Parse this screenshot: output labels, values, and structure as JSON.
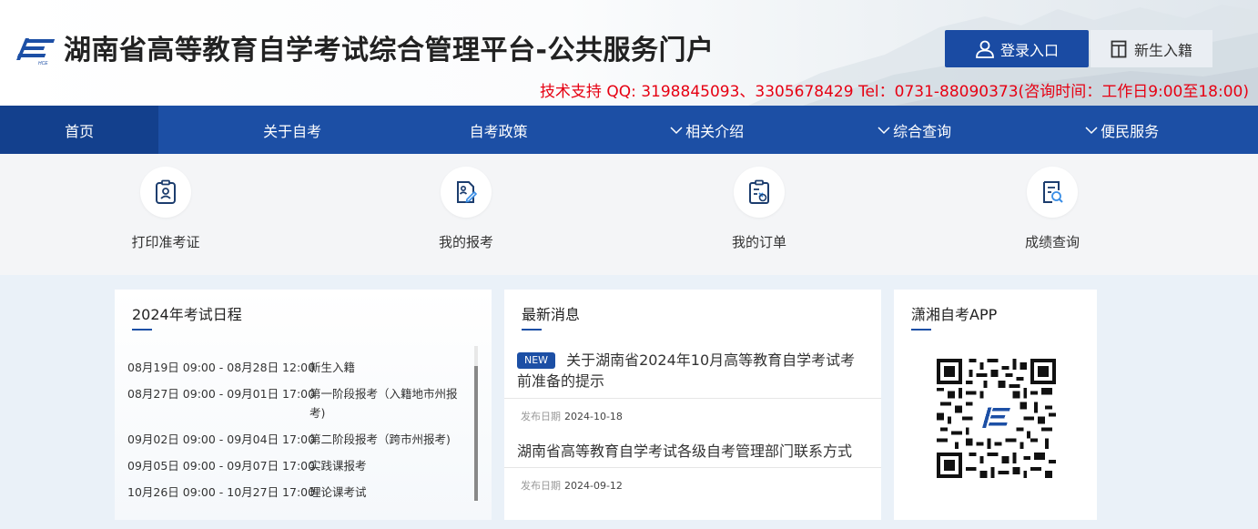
{
  "header": {
    "site_title": "湖南省高等教育自学考试综合管理平台-公共服务门户",
    "login_label": "登录入口",
    "enroll_label": "新生入籍",
    "support_text": "技术支持 QQ: 3198845093、3305678429 Tel：0731-88090373(咨询时间：工作日9:00至18:00)"
  },
  "nav": {
    "items": [
      {
        "label": "首页"
      },
      {
        "label": "关于自考"
      },
      {
        "label": "自考政策"
      },
      {
        "label": "相关介绍"
      },
      {
        "label": "综合查询"
      },
      {
        "label": "便民服务"
      }
    ]
  },
  "shortcuts": [
    {
      "label": "打印准考证",
      "icon": "admission-ticket-icon"
    },
    {
      "label": "我的报考",
      "icon": "registration-file-icon"
    },
    {
      "label": "我的订单",
      "icon": "order-clipboard-icon"
    },
    {
      "label": "成绩查询",
      "icon": "score-search-icon"
    }
  ],
  "schedule": {
    "title": "2024年考试日程",
    "items": [
      {
        "time": "08月19日 09:00 - 08月28日 12:00",
        "text": "新生入籍"
      },
      {
        "time": "08月27日 09:00 - 09月01日 17:00",
        "text": "第一阶段报考（入籍地市州报考)"
      },
      {
        "time": "09月02日 09:00 - 09月04日 17:00",
        "text": "第二阶段报考（跨市州报考)"
      },
      {
        "time": "09月05日 09:00 - 09月07日 17:00",
        "text": "实践课报考"
      },
      {
        "time": "10月26日 09:00 - 10月27日 17:00",
        "text": "理论课考试"
      }
    ]
  },
  "news": {
    "title": "最新消息",
    "badge": "NEW",
    "date_label": "发布日期",
    "items": [
      {
        "title": "关于湖南省2024年10月高等教育自学考试考前准备的提示",
        "date": "2024-10-18"
      },
      {
        "title": "湖南省高等教育自学考试各级自考管理部门联系方式",
        "date": "2024-09-12"
      }
    ]
  },
  "app": {
    "title": "潇湘自考APP"
  },
  "colors": {
    "primary": "#1c4fa5",
    "nav_active": "#13408d",
    "support_red": "#e60012"
  }
}
